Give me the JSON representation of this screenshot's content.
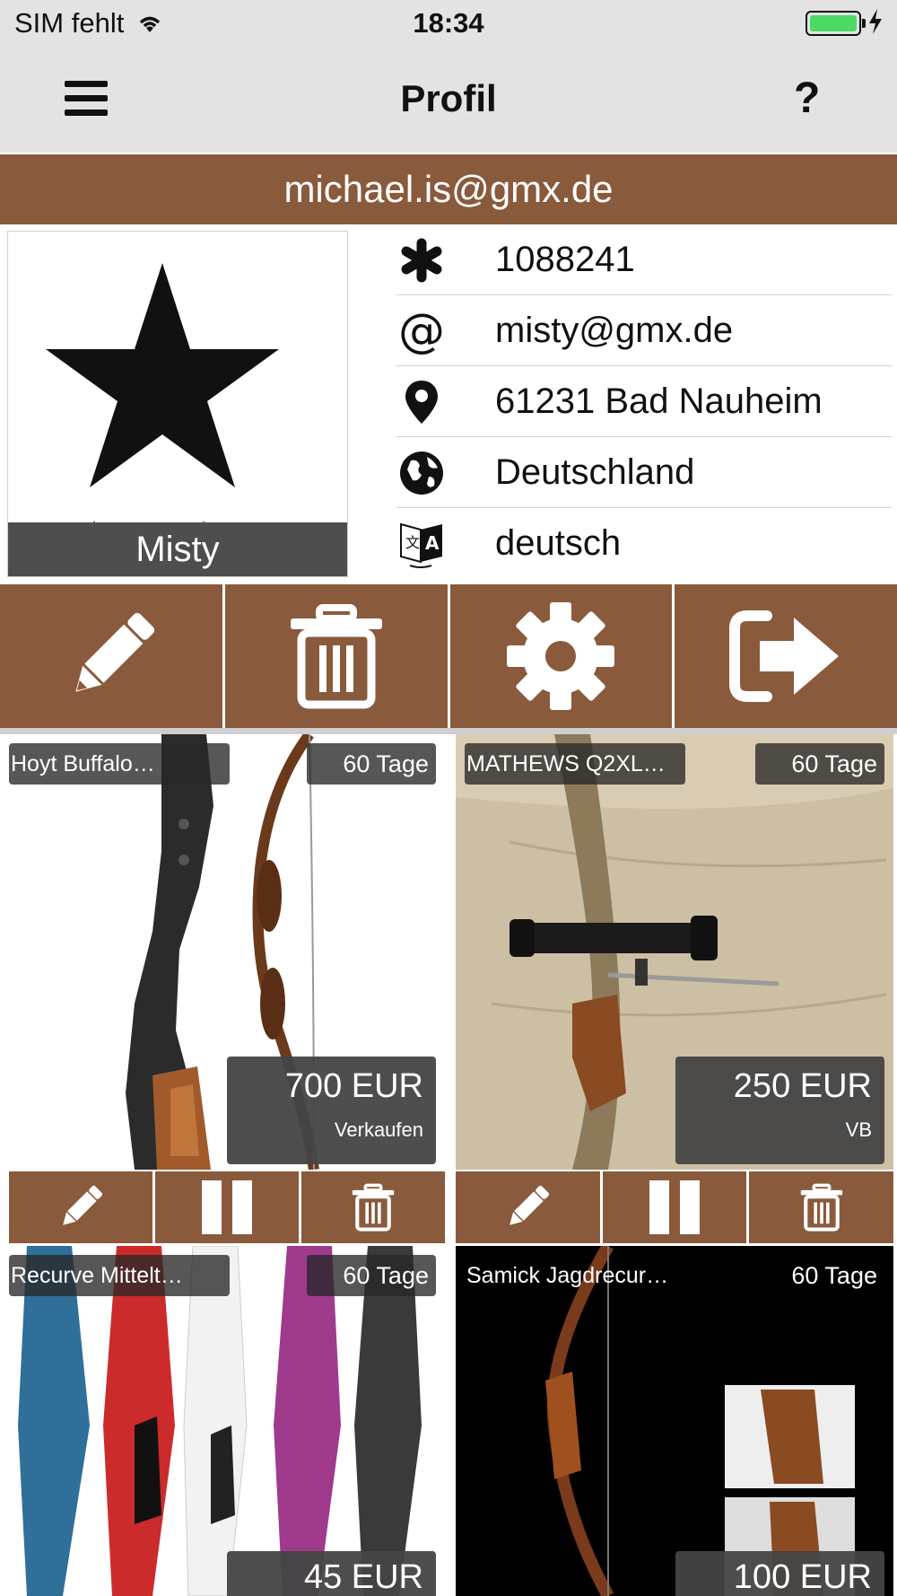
{
  "status_bar": {
    "carrier": "SIM fehlt",
    "time": "18:34"
  },
  "nav": {
    "title": "Profil",
    "help": "?"
  },
  "account": {
    "email": "michael.is@gmx.de"
  },
  "profile": {
    "avatar_name": "Misty",
    "fields": [
      {
        "icon": "asterisk-icon",
        "value": "1088241"
      },
      {
        "icon": "at-icon",
        "value": "misty@gmx.de"
      },
      {
        "icon": "location-pin-icon",
        "value": "61231 Bad Nauheim"
      },
      {
        "icon": "globe-icon",
        "value": "Deutschland"
      },
      {
        "icon": "translate-icon",
        "value": "deutsch"
      }
    ]
  },
  "actions": [
    {
      "icon": "pencil-icon"
    },
    {
      "icon": "trash-icon"
    },
    {
      "icon": "gear-icon"
    },
    {
      "icon": "logout-icon"
    }
  ],
  "listings": [
    {
      "title": "Hoyt Buffalo…",
      "days": "60 Tage",
      "price": "700 EUR",
      "note": "Verkaufen"
    },
    {
      "title": "MATHEWS Q2XL…",
      "days": "60 Tage",
      "price": "250 EUR",
      "note": "VB"
    },
    {
      "title": "Recurve Mittelt…",
      "days": "60 Tage",
      "price": "45 EUR",
      "note": ""
    },
    {
      "title": "Samick Jagdrecur…",
      "days": "60 Tage",
      "price": "100 EUR",
      "note": ""
    }
  ],
  "colors": {
    "brand_brown": "#8a5a3c",
    "nav_bg": "#e3e3e3",
    "battery_green": "#4cd964"
  }
}
